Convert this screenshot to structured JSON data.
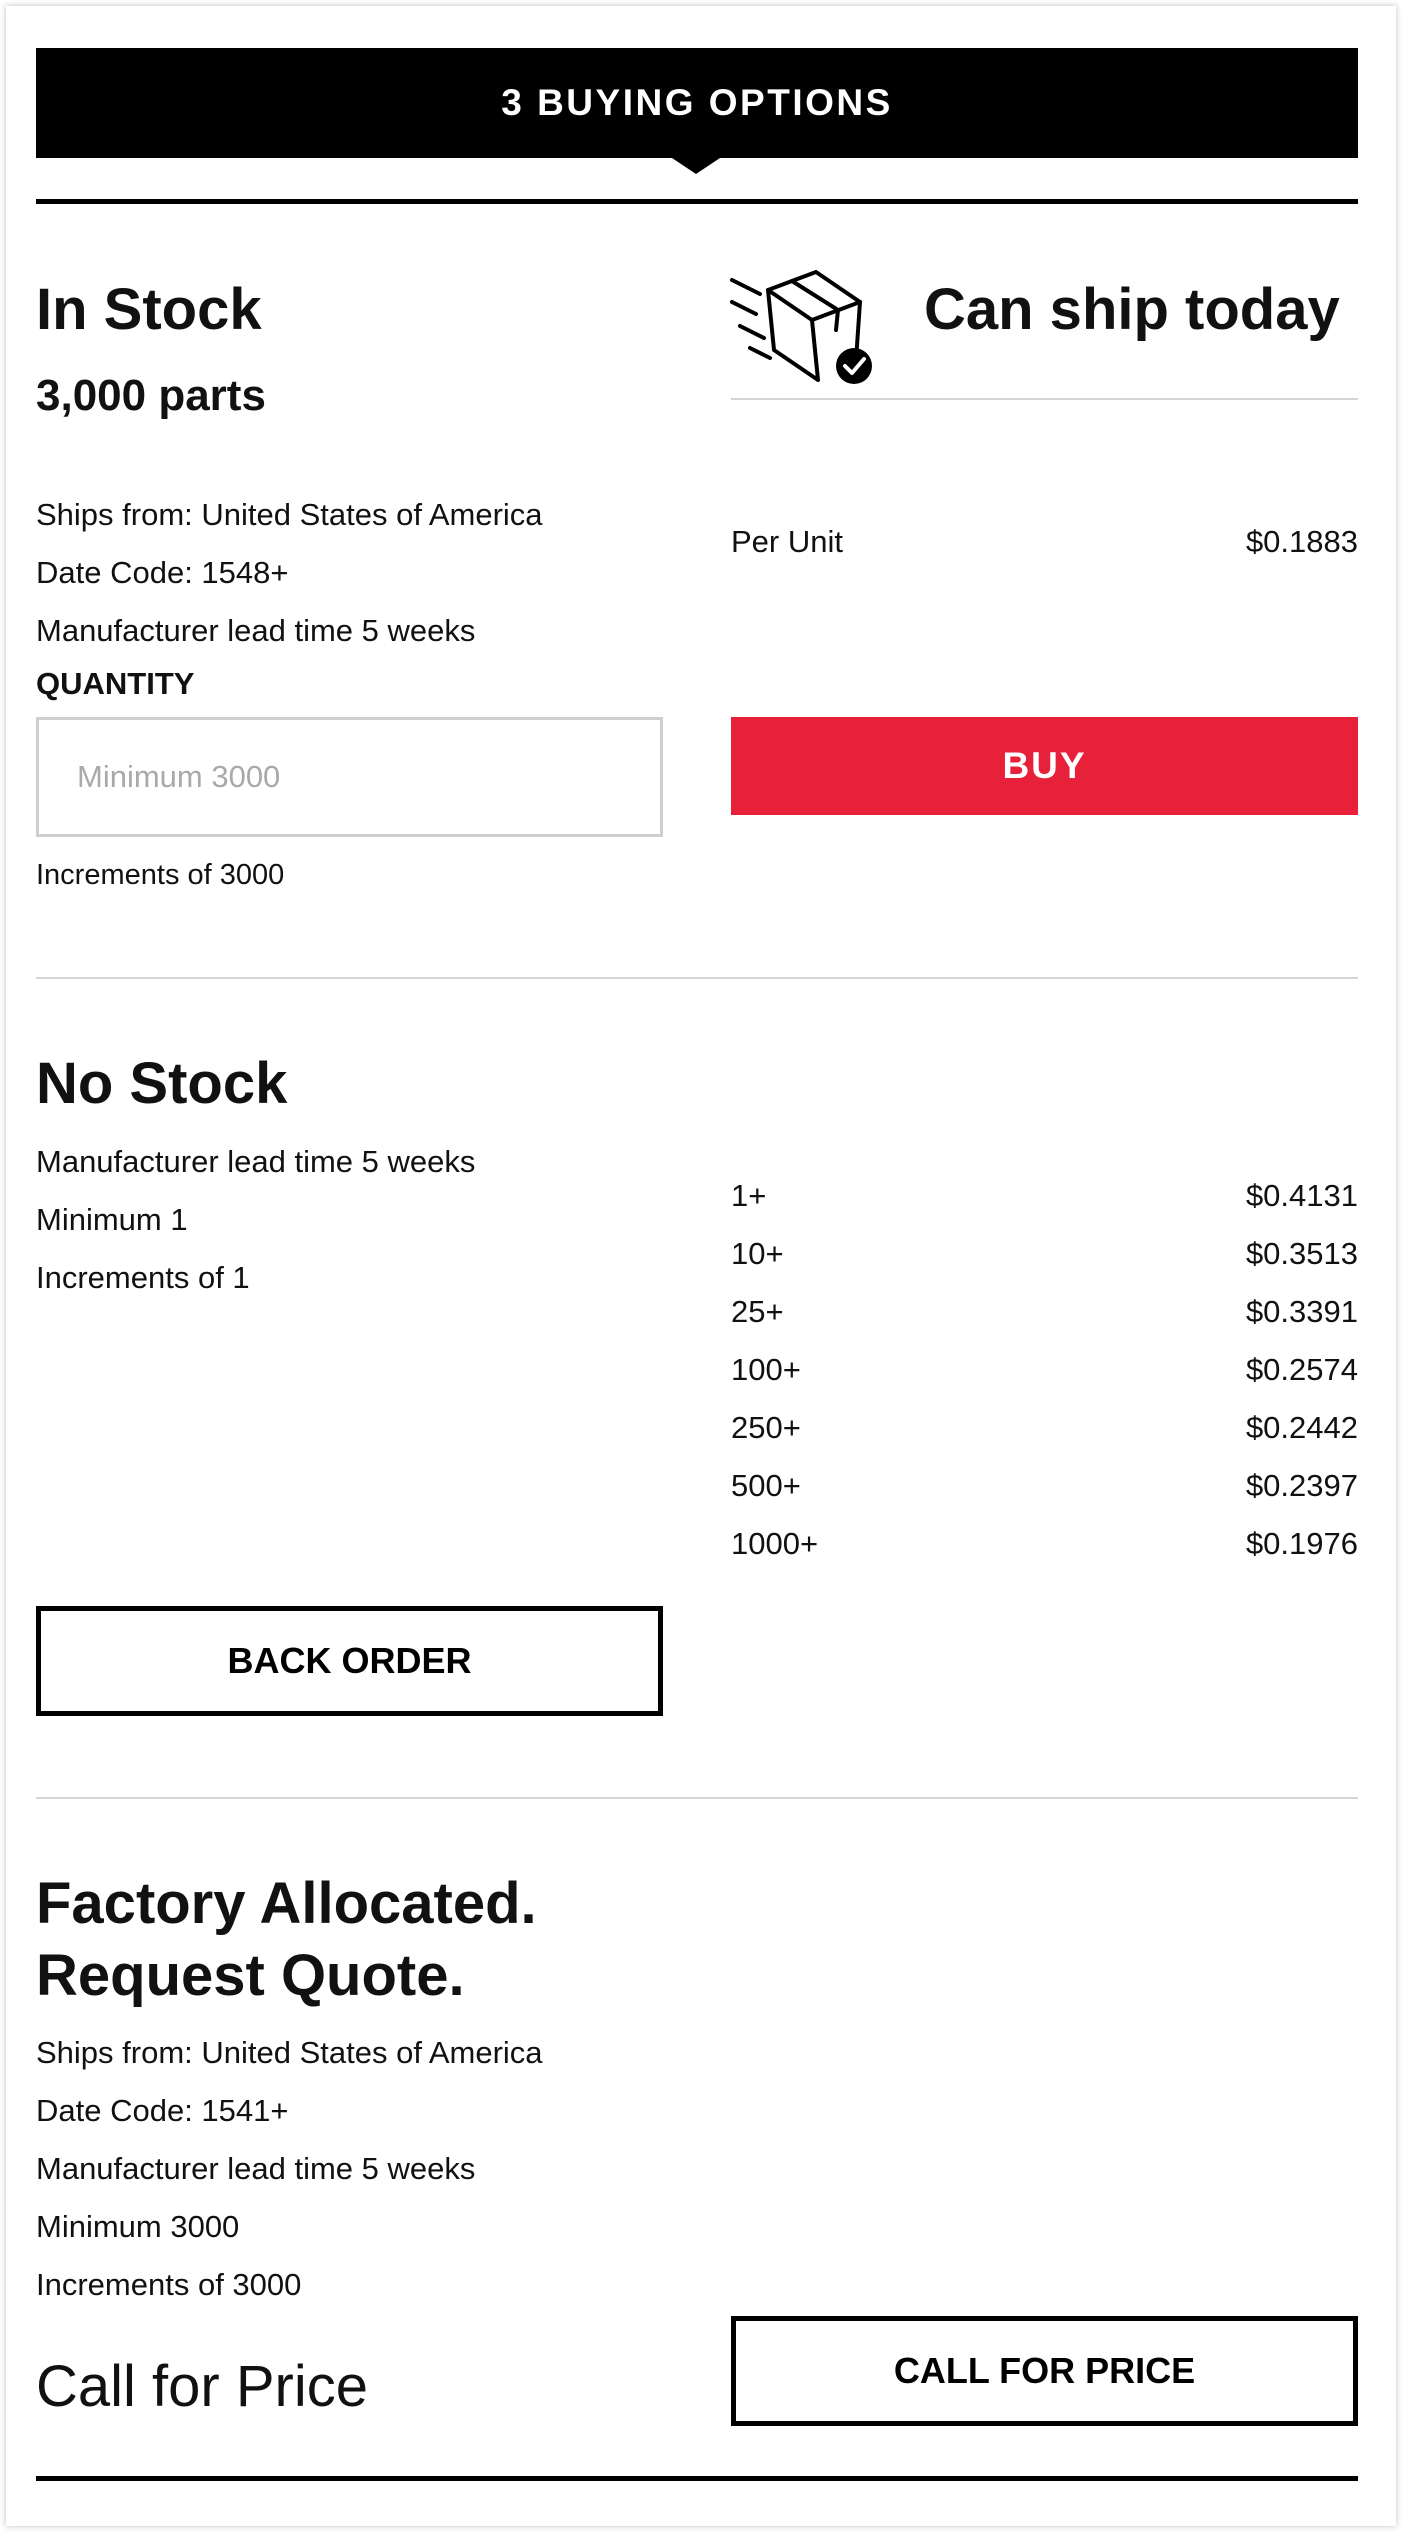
{
  "header": {
    "title": "3 BUYING OPTIONS"
  },
  "in_stock": {
    "title": "In Stock",
    "parts": "3,000 parts",
    "ships_from": "Ships from: United States of America",
    "date_code": "Date Code: 1548+",
    "lead_time": "Manufacturer lead time 5 weeks",
    "quantity_label": "QUANTITY",
    "quantity_placeholder": "Minimum 3000",
    "increments": "Increments of 3000",
    "ship_status": "Can ship today",
    "ship_icon": "package-ship-check-icon",
    "price_label": "Per Unit",
    "price_value": "$0.1883",
    "buy_label": "BUY"
  },
  "no_stock": {
    "title": "No Stock",
    "lead_time": "Manufacturer lead time 5 weeks",
    "minimum": "Minimum 1",
    "increments": "Increments of 1",
    "price_breaks": [
      {
        "qty": "1+",
        "price": "$0.4131"
      },
      {
        "qty": "10+",
        "price": "$0.3513"
      },
      {
        "qty": "25+",
        "price": "$0.3391"
      },
      {
        "qty": "100+",
        "price": "$0.2574"
      },
      {
        "qty": "250+",
        "price": "$0.2442"
      },
      {
        "qty": "500+",
        "price": "$0.2397"
      },
      {
        "qty": "1000+",
        "price": "$0.1976"
      }
    ],
    "back_order_label": "BACK ORDER"
  },
  "factory": {
    "title_line1": "Factory Allocated.",
    "title_line2": "Request Quote.",
    "ships_from": "Ships from: United States of America",
    "date_code": "Date Code: 1541+",
    "lead_time": "Manufacturer lead time 5 weeks",
    "minimum": "Minimum 3000",
    "increments": "Increments of 3000",
    "call_for_price_text": "Call for Price",
    "call_for_price_button": "CALL FOR PRICE"
  },
  "colors": {
    "accent": "#e8213a",
    "header_bg": "#000000",
    "divider": "#d4d4d4"
  }
}
